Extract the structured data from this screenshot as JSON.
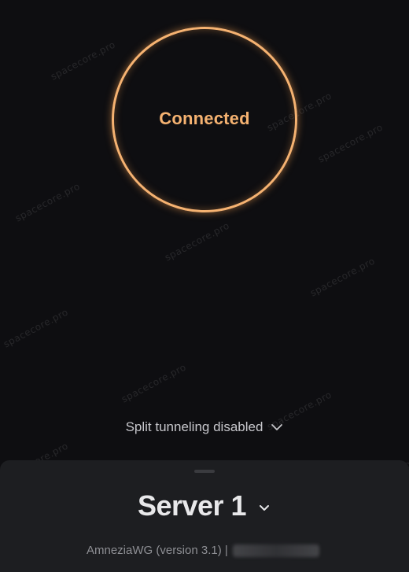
{
  "connection": {
    "status_label": "Connected",
    "ring_color": "#f5b271"
  },
  "split_tunneling": {
    "label": "Split tunneling disabled",
    "icon": "chevron-down-icon"
  },
  "server_sheet": {
    "server_name": "Server 1",
    "selector_icon": "chevron-down-icon",
    "description_prefix": "AmneziaWG (version 3.1) |"
  },
  "watermark": {
    "text": "spacecore.pro"
  },
  "colors": {
    "background": "#0e0e11",
    "sheet": "#1d1e21",
    "accent": "#f5b271"
  }
}
